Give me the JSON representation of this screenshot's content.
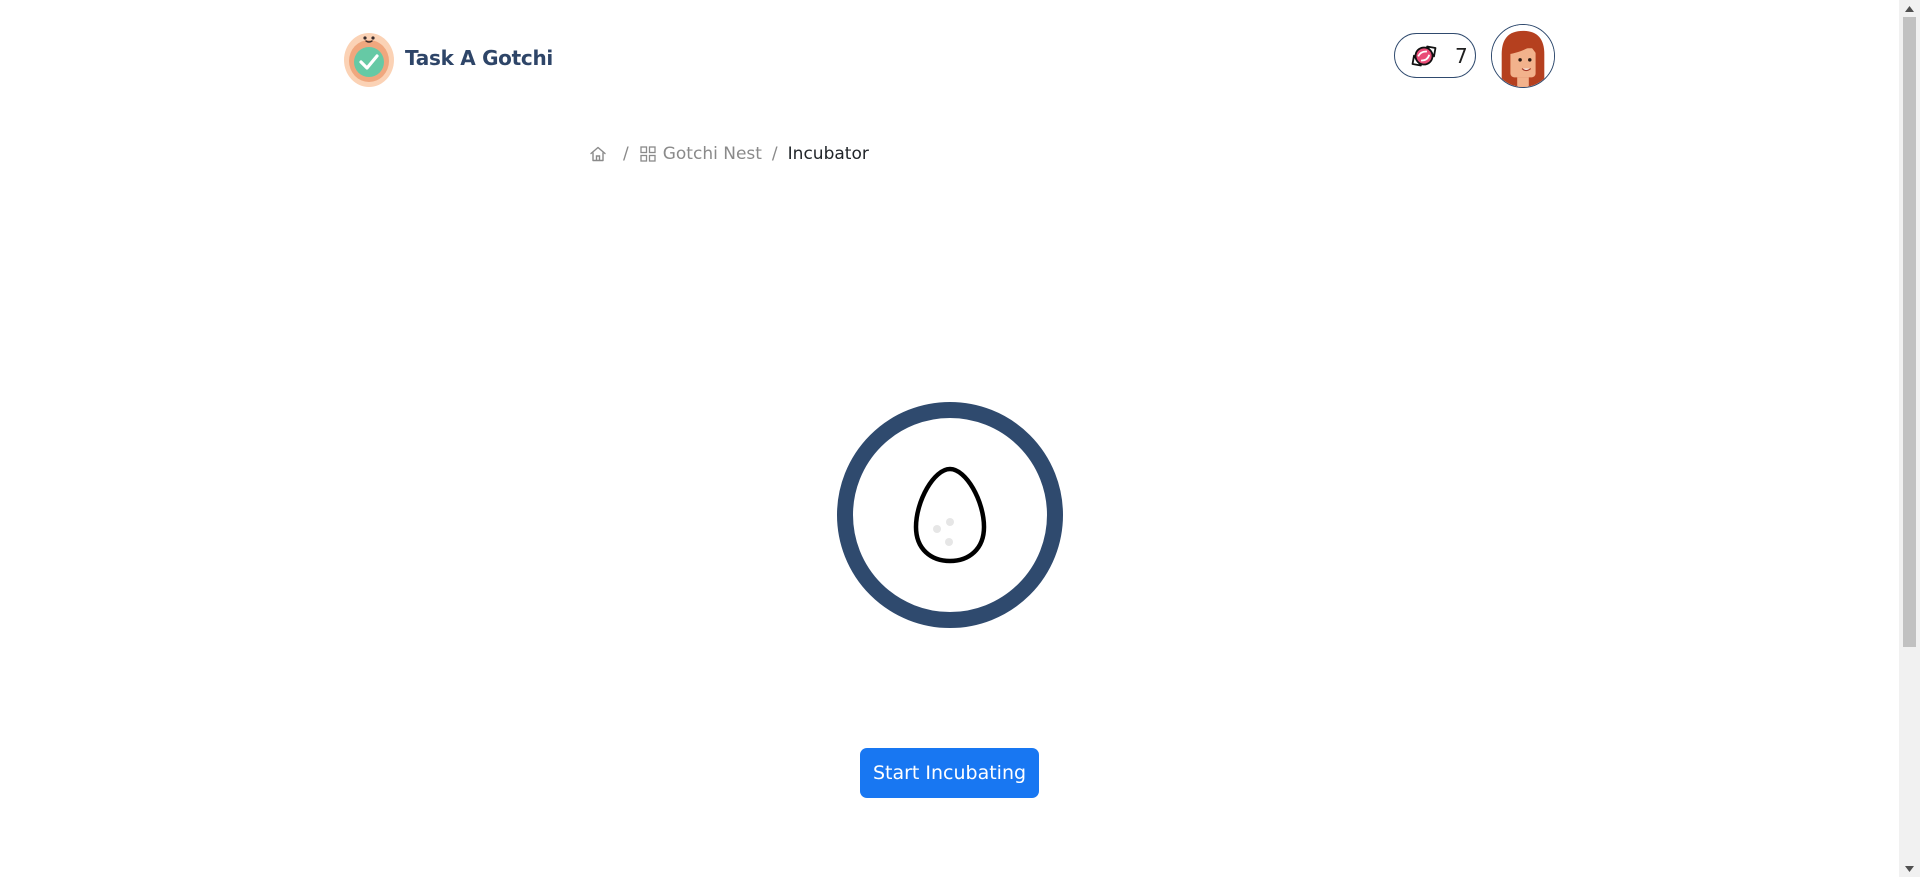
{
  "app": {
    "title": "Task A Gotchi"
  },
  "header": {
    "candy_count": "7"
  },
  "breadcrumb": {
    "items": [
      {
        "label": "",
        "icon": "home-icon"
      },
      {
        "label": "Gotchi Nest",
        "icon": "grid-icon"
      },
      {
        "label": "Incubator"
      }
    ],
    "separator": "/"
  },
  "incubator": {
    "ring_color": "#2f4a6e",
    "egg_icon": "egg-icon"
  },
  "actions": {
    "start_label": "Start Incubating",
    "button_color": "#1877f2"
  }
}
